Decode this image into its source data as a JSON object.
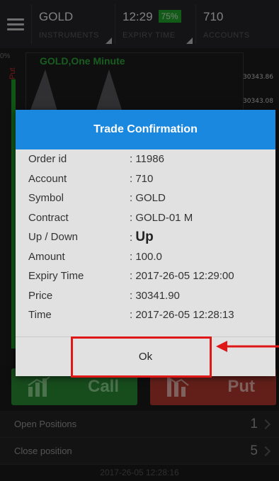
{
  "header": {
    "instrument_value": "GOLD",
    "instrument_label": "INSTRUMENTS",
    "expiry_value": "12:29",
    "payout_badge": "75%",
    "expiry_label": "EXPIRY TIME",
    "account_value": "710",
    "account_label": "ACCOUNTS"
  },
  "chart": {
    "title": "GOLD,One Minute",
    "gauge_pct": "0%",
    "put_label": "Put",
    "price_labels": [
      "30343.86",
      "30343.08"
    ]
  },
  "dialog": {
    "title": "Trade Confirmation",
    "rows": [
      {
        "key": "Order id",
        "value": ": 11986"
      },
      {
        "key": "Account",
        "value": ": 710"
      },
      {
        "key": "Symbol",
        "value": ": GOLD"
      },
      {
        "key": "Contract",
        "value": ": GOLD-01 M"
      },
      {
        "key": "Up / Down",
        "value_prefix": ": ",
        "value": "Up"
      },
      {
        "key": "Amount",
        "value": ": 100.0"
      },
      {
        "key": "Expiry Time",
        "value": ": 2017-26-05 12:29:00"
      },
      {
        "key": "Price",
        "value": ": 30341.90"
      },
      {
        "key": "Time",
        "value": ": 2017-26-05 12:28:13"
      }
    ],
    "ok_label": "Ok"
  },
  "trade": {
    "call_label": "Call",
    "put_label": "Put"
  },
  "positions": {
    "open_label": "Open Positions",
    "open_count": "1",
    "close_label": "Close position",
    "close_count": "5"
  },
  "footer": {
    "time": "2017-26-05 12:28:16"
  },
  "colors": {
    "dialog_header": "#1b88e0",
    "call": "#2b8a36",
    "put": "#b3392f",
    "annotation": "#e01717"
  }
}
